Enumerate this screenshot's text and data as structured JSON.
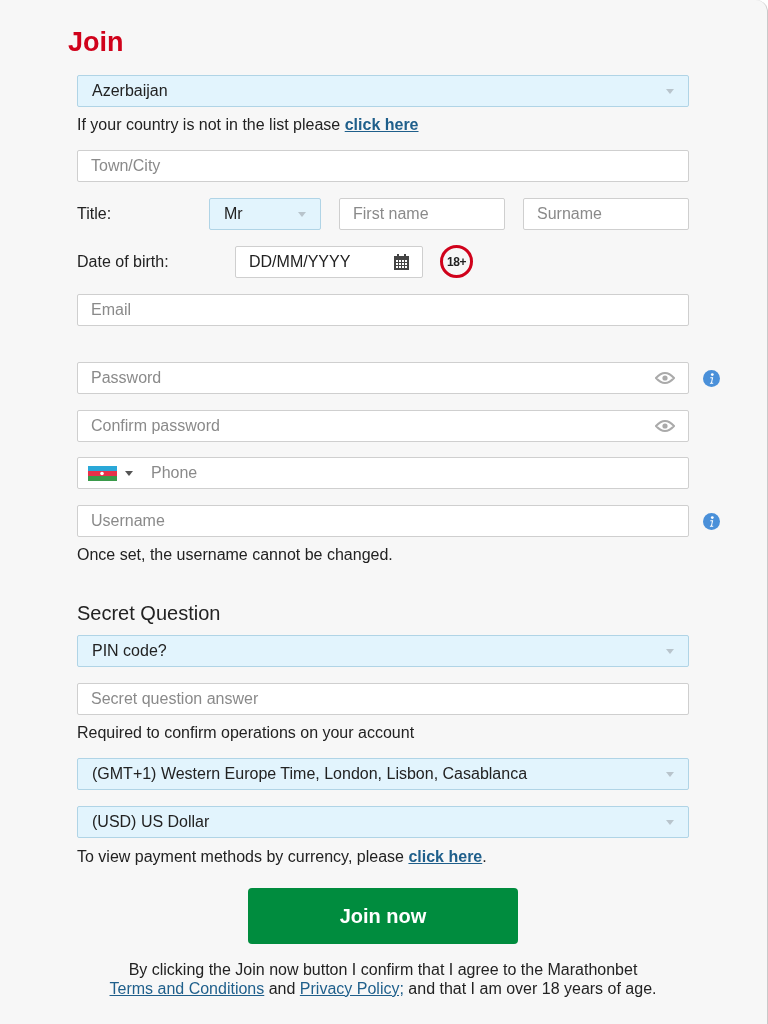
{
  "title": "Join",
  "country": {
    "value": "Azerbaijan"
  },
  "country_note": {
    "text": "If your country is not in the list please",
    "link": "click here"
  },
  "town": {
    "placeholder": "Town/City"
  },
  "name_row": {
    "label": "Title:",
    "title_value": "Mr",
    "first_name": {
      "placeholder": "First name"
    },
    "surname": {
      "placeholder": "Surname"
    }
  },
  "birth": {
    "label": "Date of birth:",
    "placeholder": "DD/MM/YYYY",
    "age_badge": "18+"
  },
  "email": {
    "placeholder": "Email"
  },
  "password": {
    "placeholder": "Password"
  },
  "confirm_password": {
    "placeholder": "Confirm password"
  },
  "phone": {
    "placeholder": "Phone"
  },
  "username": {
    "placeholder": "Username"
  },
  "username_note": "Once set, the username cannot be changed.",
  "secret_heading": "Secret Question",
  "secret_question": {
    "value": "PIN code?"
  },
  "secret_answer": {
    "placeholder": "Secret question answer"
  },
  "secret_note": "Required to confirm operations on your account",
  "timezone": {
    "value": "(GMT+1) Western Europe Time, London, Lisbon, Casablanca"
  },
  "currency": {
    "value": "(USD) US Dollar"
  },
  "currency_note": {
    "text": "To view payment methods by currency, please",
    "link": "click here",
    "end": "."
  },
  "join_button": "Join now",
  "terms": {
    "text": "By clicking the Join now button I confirm that I agree to the Marathonbet",
    "link1": "Terms and Conditions",
    "mid": "and",
    "link2": "Privacy Policy;",
    "end": "and that I am over 18 years of age."
  }
}
